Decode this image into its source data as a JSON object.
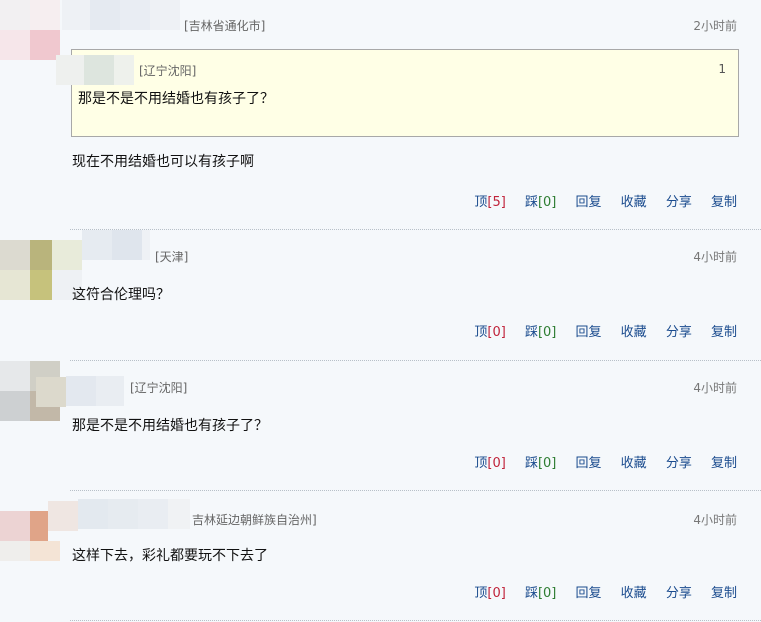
{
  "comments": [
    {
      "location": "[吉林省通化市]",
      "time": "2小时前",
      "quote": {
        "location": "[辽宁沈阳]",
        "floor": "1",
        "text": "那是不是不用结婚也有孩子了？"
      },
      "text": "现在不用结婚也可以有孩子啊",
      "actions": {
        "up_label": "顶",
        "up_count": "[5]",
        "down_label": "踩",
        "down_count": "[0]",
        "reply": "回复",
        "favorite": "收藏",
        "share": "分享",
        "copy": "复制"
      }
    },
    {
      "location": "[天津]",
      "time": "4小时前",
      "text": "这符合伦理吗？",
      "actions": {
        "up_label": "顶",
        "up_count": "[0]",
        "down_label": "踩",
        "down_count": "[0]",
        "reply": "回复",
        "favorite": "收藏",
        "share": "分享",
        "copy": "复制"
      }
    },
    {
      "location": "[辽宁沈阳]",
      "time": "4小时前",
      "text": "那是不是不用结婚也有孩子了？",
      "actions": {
        "up_label": "顶",
        "up_count": "[0]",
        "down_label": "踩",
        "down_count": "[0]",
        "reply": "回复",
        "favorite": "收藏",
        "share": "分享",
        "copy": "复制"
      }
    },
    {
      "location": "吉林延边朝鲜族自治州]",
      "time": "4小时前",
      "text": "这样下去，彩礼都要玩不下去了",
      "actions": {
        "up_label": "顶",
        "up_count": "[0]",
        "down_label": "踩",
        "down_count": "[0]",
        "reply": "回复",
        "favorite": "收藏",
        "share": "分享",
        "copy": "复制"
      }
    }
  ]
}
